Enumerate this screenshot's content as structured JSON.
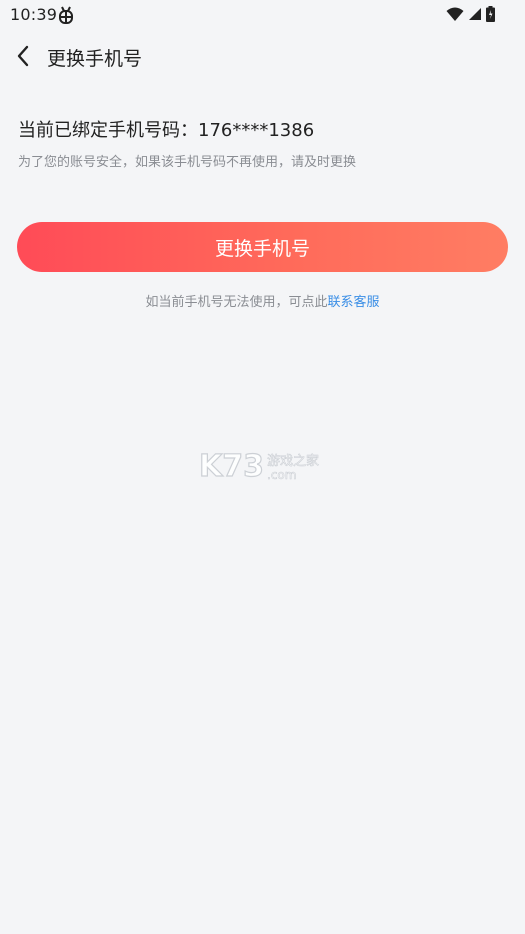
{
  "status_bar": {
    "time": "10:39"
  },
  "header": {
    "title": "更换手机号"
  },
  "content": {
    "bound_phone_label": "当前已绑定手机号码：",
    "bound_phone_number": "176****1386",
    "safety_tip": "为了您的账号安全，如果该手机号码不再使用，请及时更换",
    "change_button_label": "更换手机号",
    "help_prefix": "如当前手机号无法使用，可点此",
    "help_link": "联系客服"
  },
  "watermark": {
    "brand": "K73",
    "tagline": "游戏之家",
    "domain": ".com"
  },
  "colors": {
    "background": "#f4f5f7",
    "button_gradient_start": "#ff4b57",
    "button_gradient_end": "#ff7d63",
    "link": "#3a8ee6",
    "muted_text": "#8a8d93"
  }
}
